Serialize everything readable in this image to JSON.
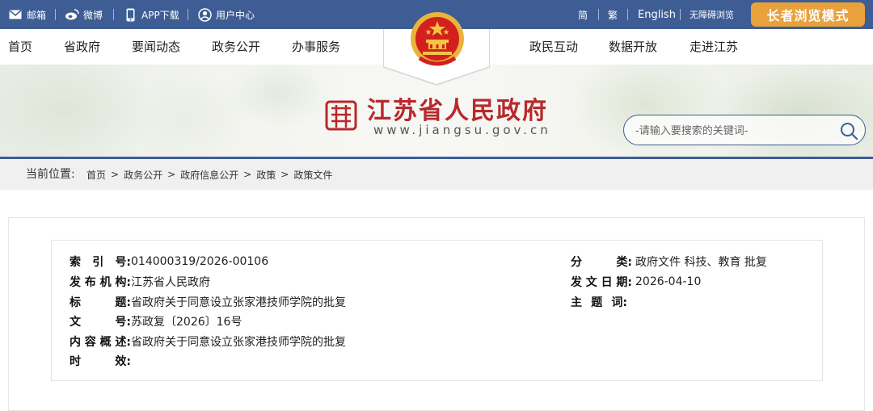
{
  "topbar": {
    "mail": "邮箱",
    "weibo": "微博",
    "app": "APP下载",
    "user": "用户中心",
    "simplified": "简",
    "traditional": "繁",
    "english": "English",
    "accessibility": "无障碍浏览",
    "elder_mode": "长者浏览模式"
  },
  "nav": {
    "left": [
      "首页",
      "省政府",
      "要闻动态",
      "政务公开",
      "办事服务"
    ],
    "right": [
      "政民互动",
      "数据开放",
      "走进江苏"
    ]
  },
  "banner": {
    "title": "江苏省人民政府",
    "url": "www.jiangsu.gov.cn",
    "search_placeholder": "-请输入要搜索的关键词-"
  },
  "breadcrumb": {
    "label": "当前位置:",
    "items": [
      "首页",
      "政务公开",
      "政府信息公开",
      "政策",
      "政策文件"
    ]
  },
  "meta": {
    "index_label": [
      "索",
      "引",
      "号:"
    ],
    "index_value": "014000319/2026-00106",
    "publisher_label": [
      "发",
      "布",
      "机",
      "构:"
    ],
    "publisher_value": "江苏省人民政府",
    "title_label": [
      "标",
      "题:"
    ],
    "title_value": "省政府关于同意设立张家港技师学院的批复",
    "docno_label": [
      "文",
      "号:"
    ],
    "docno_value": "苏政复〔2026〕16号",
    "summary_label": [
      "内",
      "容",
      "概",
      "述:"
    ],
    "summary_value": "省政府关于同意设立张家港技师学院的批复",
    "validity_label": [
      "时",
      "效:"
    ],
    "validity_value": "",
    "category_label": [
      "分",
      "类:"
    ],
    "category_value": "政府文件 科技、教育 批复",
    "date_label": [
      "发",
      "文",
      "日",
      "期:"
    ],
    "date_value": "2026-04-10",
    "subject_label": [
      "主",
      "题",
      "词:"
    ],
    "subject_value": ""
  },
  "colors": {
    "topbar": "#3e5d95",
    "elder_button": "#e9a13c",
    "title_red": "#b8282c"
  }
}
